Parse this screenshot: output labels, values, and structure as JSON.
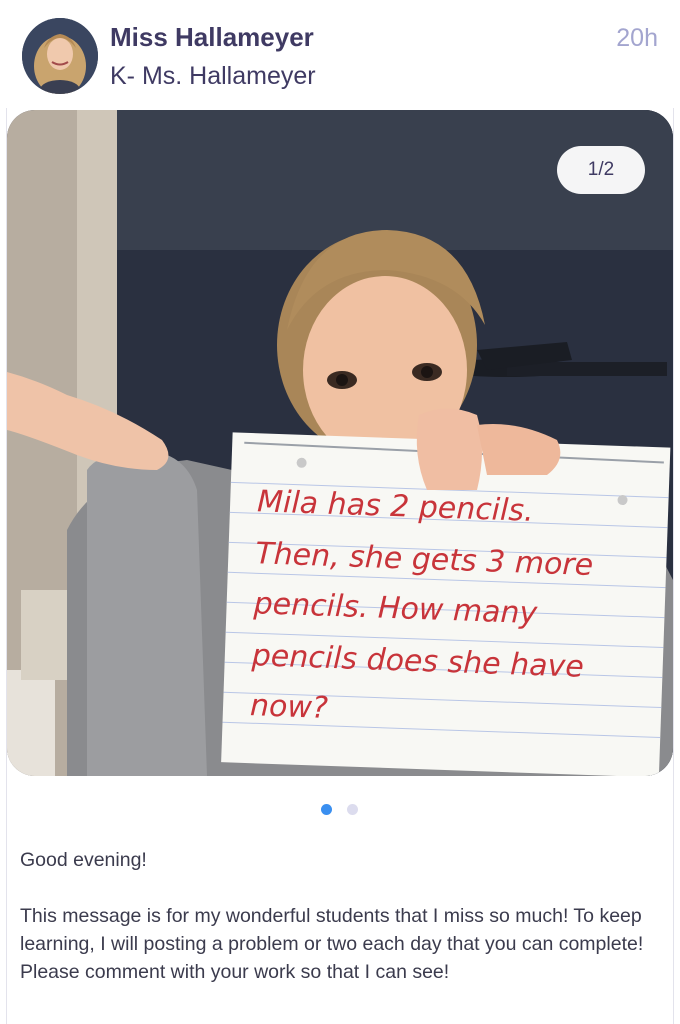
{
  "post": {
    "author_name": "Miss Hallameyer",
    "class_name": "K- Ms. Hallameyer",
    "timestamp": "20h"
  },
  "gallery": {
    "counter": "1/2",
    "current_index": 1,
    "total": 2
  },
  "photo_note": {
    "lines": [
      "Mila has 2 pencils.",
      "Then, she gets 3 more",
      "pencils. How many",
      "pencils does she have",
      "now?"
    ]
  },
  "message": {
    "greeting": "Good evening!",
    "body": "This message is for my wonderful students that I miss so much! To keep learning, I will posting a problem or two each day that you can complete! Please comment with your work so that I can see!"
  },
  "colors": {
    "accent": "#3a8ff0",
    "author_text": "#3f3a63",
    "timestamp_text": "#a3a5cf",
    "note_ink": "#c8343a"
  }
}
